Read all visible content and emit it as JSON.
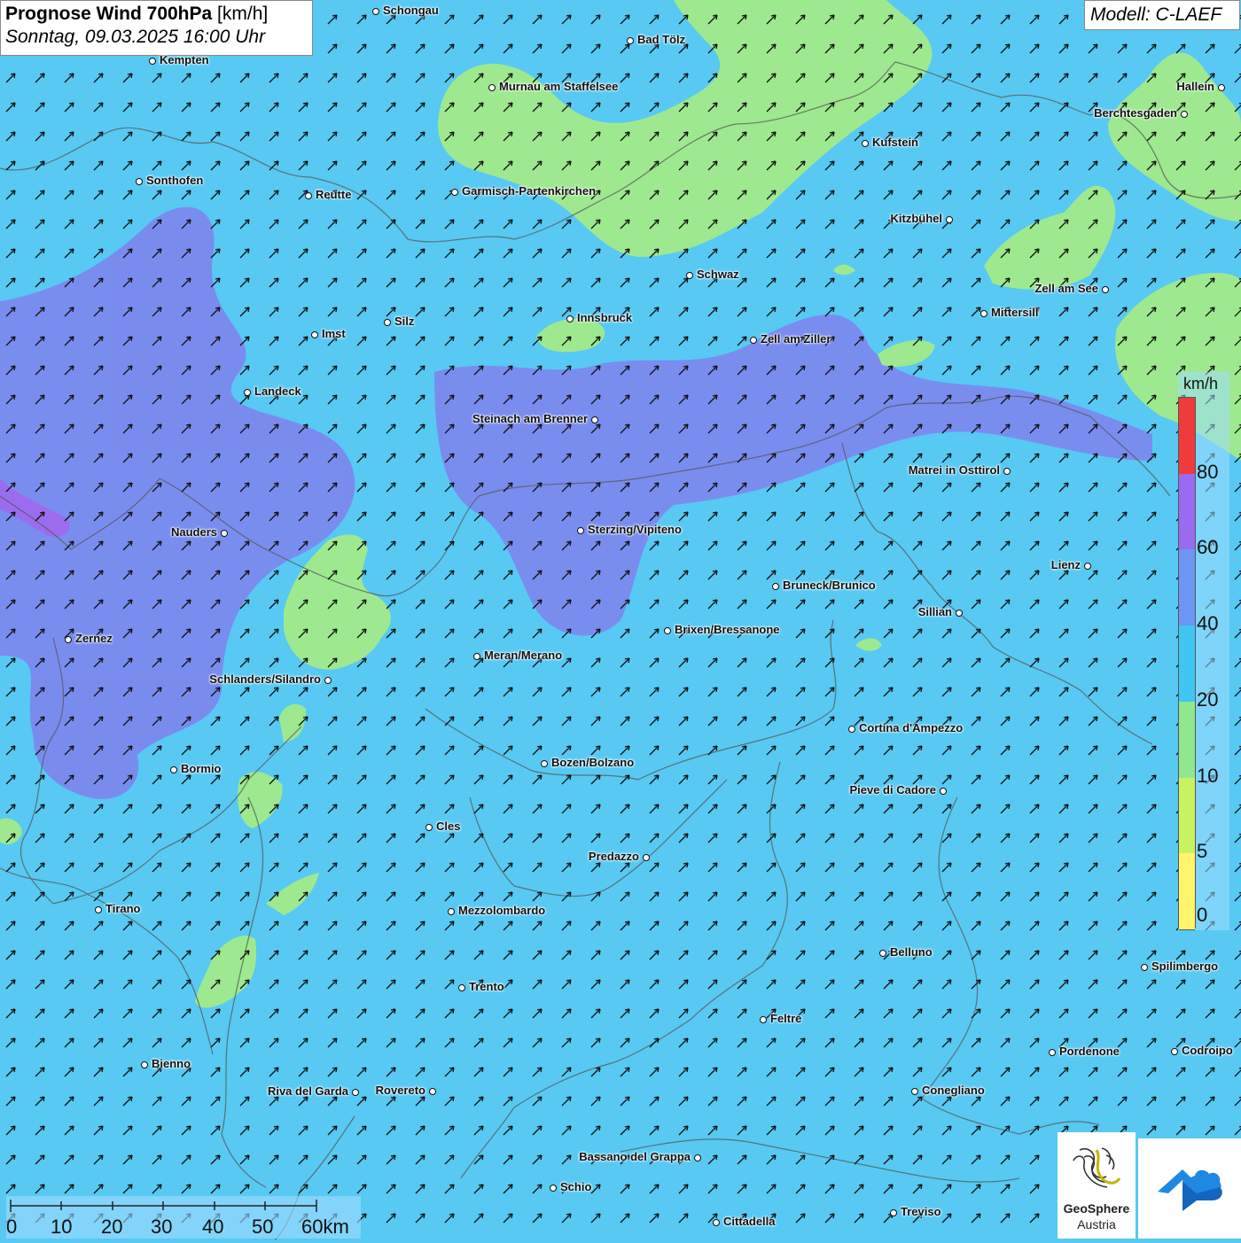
{
  "header": {
    "title_bold": "Prognose Wind 700hPa",
    "title_unit": " [km/h]",
    "date": "Sonntag, 09.03.2025 16:00 Uhr",
    "model": "Modell: C-LAEF"
  },
  "colors": {
    "wind_10_20": "#57c9f3",
    "wind_20_40": "#6b8ff0",
    "wind_40_60": "#8a6ef0",
    "wind_5_10": "#9ee88f",
    "arrow": "#111111"
  },
  "legend": {
    "unit": "km/h",
    "labels": [
      "80",
      "60",
      "40",
      "20",
      "10",
      "5",
      "0"
    ],
    "bands": [
      {
        "color": "#ef3b3b"
      },
      {
        "color": "#9a6af0"
      },
      {
        "color": "#6b96f2"
      },
      {
        "color": "#3fc6f2"
      },
      {
        "color": "#8fe88f"
      },
      {
        "color": "#c9f261"
      },
      {
        "color": "#fff46a"
      }
    ]
  },
  "wind_direction": "north-east",
  "cities": [
    {
      "name": "Schongau"
    },
    {
      "name": "Bad Tölz"
    },
    {
      "name": "Kempten"
    },
    {
      "name": "Murnau am Staffelsee"
    },
    {
      "name": "Hallein"
    },
    {
      "name": "Berchtesgaden"
    },
    {
      "name": "Kufstein"
    },
    {
      "name": "Sonthofen"
    },
    {
      "name": "Reutte"
    },
    {
      "name": "Garmisch-Partenkirchen"
    },
    {
      "name": "Kitzbühel"
    },
    {
      "name": "Schwaz"
    },
    {
      "name": "Zell am See"
    },
    {
      "name": "Mittersill"
    },
    {
      "name": "Imst"
    },
    {
      "name": "Silz"
    },
    {
      "name": "Innsbruck"
    },
    {
      "name": "Zell am Ziller"
    },
    {
      "name": "Landeck"
    },
    {
      "name": "Steinach am Brenner"
    },
    {
      "name": "Matrei in Osttirol"
    },
    {
      "name": "Nauders"
    },
    {
      "name": "Sterzing/Vipiteno"
    },
    {
      "name": "Lienz"
    },
    {
      "name": "Bruneck/Brunico"
    },
    {
      "name": "Sillian"
    },
    {
      "name": "Brixen/Bressanone"
    },
    {
      "name": "Zernez"
    },
    {
      "name": "Meran/Merano"
    },
    {
      "name": "Schlanders/Silandro"
    },
    {
      "name": "Cortina d'Ampezzo"
    },
    {
      "name": "Bozen/Bolzano"
    },
    {
      "name": "Bormio"
    },
    {
      "name": "Pieve di Cadore"
    },
    {
      "name": "Cles"
    },
    {
      "name": "Predazzo"
    },
    {
      "name": "Tirano"
    },
    {
      "name": "Mezzolombardo"
    },
    {
      "name": "Belluno"
    },
    {
      "name": "Spilimbergo"
    },
    {
      "name": "Trento"
    },
    {
      "name": "Feltre"
    },
    {
      "name": "Bienno"
    },
    {
      "name": "Pordenone"
    },
    {
      "name": "Codroipo"
    },
    {
      "name": "Riva del Garda"
    },
    {
      "name": "Rovereto"
    },
    {
      "name": "Conegliano"
    },
    {
      "name": "Bassano del Grappa"
    },
    {
      "name": "Schio"
    },
    {
      "name": "Treviso"
    },
    {
      "name": "Cittadella"
    }
  ],
  "scale_bar": {
    "labels": [
      "0",
      "10",
      "20",
      "30",
      "40",
      "50",
      "60km"
    ]
  },
  "logos": {
    "geosphere_line1": "GeoSphere",
    "geosphere_line2": "Austria"
  }
}
